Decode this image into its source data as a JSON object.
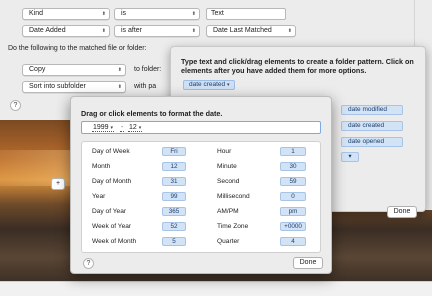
{
  "rules": {
    "row1": {
      "attribute": "Kind",
      "operator": "is",
      "value": "Text"
    },
    "row2": {
      "attribute": "Date Added",
      "operator": "is after",
      "value": "Date Last Matched"
    }
  },
  "actions": {
    "heading": "Do the following to the matched file or folder:",
    "row1": {
      "action": "Copy",
      "label": "to folder:"
    },
    "row2": {
      "action": "Sort into subfolder",
      "label": "with pa"
    }
  },
  "info_panel": {
    "instructions": "Type text and click/drag elements to create a folder pattern. Click on elements after you have added them for more options.",
    "current_token": "date created",
    "token_list": [
      "date modified",
      "date created",
      "date opened",
      "▾"
    ],
    "done_label": "Done"
  },
  "date_dialog": {
    "title": "Drag or click elements to format the date.",
    "format_tokens": [
      "1999",
      "12"
    ],
    "elements_left": [
      {
        "label": "Day of Week",
        "value": "Fri"
      },
      {
        "label": "Month",
        "value": "12"
      },
      {
        "label": "Day of Month",
        "value": "31"
      },
      {
        "label": "Year",
        "value": "99"
      },
      {
        "label": "Day of Year",
        "value": "365"
      },
      {
        "label": "Week of Year",
        "value": "52"
      },
      {
        "label": "Week of Month",
        "value": "5"
      }
    ],
    "elements_right": [
      {
        "label": "Hour",
        "value": "1"
      },
      {
        "label": "Minute",
        "value": "30"
      },
      {
        "label": "Second",
        "value": "59"
      },
      {
        "label": "Millisecond",
        "value": "0"
      },
      {
        "label": "AM/PM",
        "value": "pm"
      },
      {
        "label": "Time Zone",
        "value": "+0000"
      },
      {
        "label": "Quarter",
        "value": "4"
      }
    ],
    "done_label": "Done",
    "help_label": "?"
  },
  "main": {
    "help_label": "?",
    "plus_label": "+"
  },
  "colors": {
    "token_bg": "#d3e3f6",
    "token_border": "#a7c3e8",
    "focus_ring": "#7fa9e0"
  }
}
